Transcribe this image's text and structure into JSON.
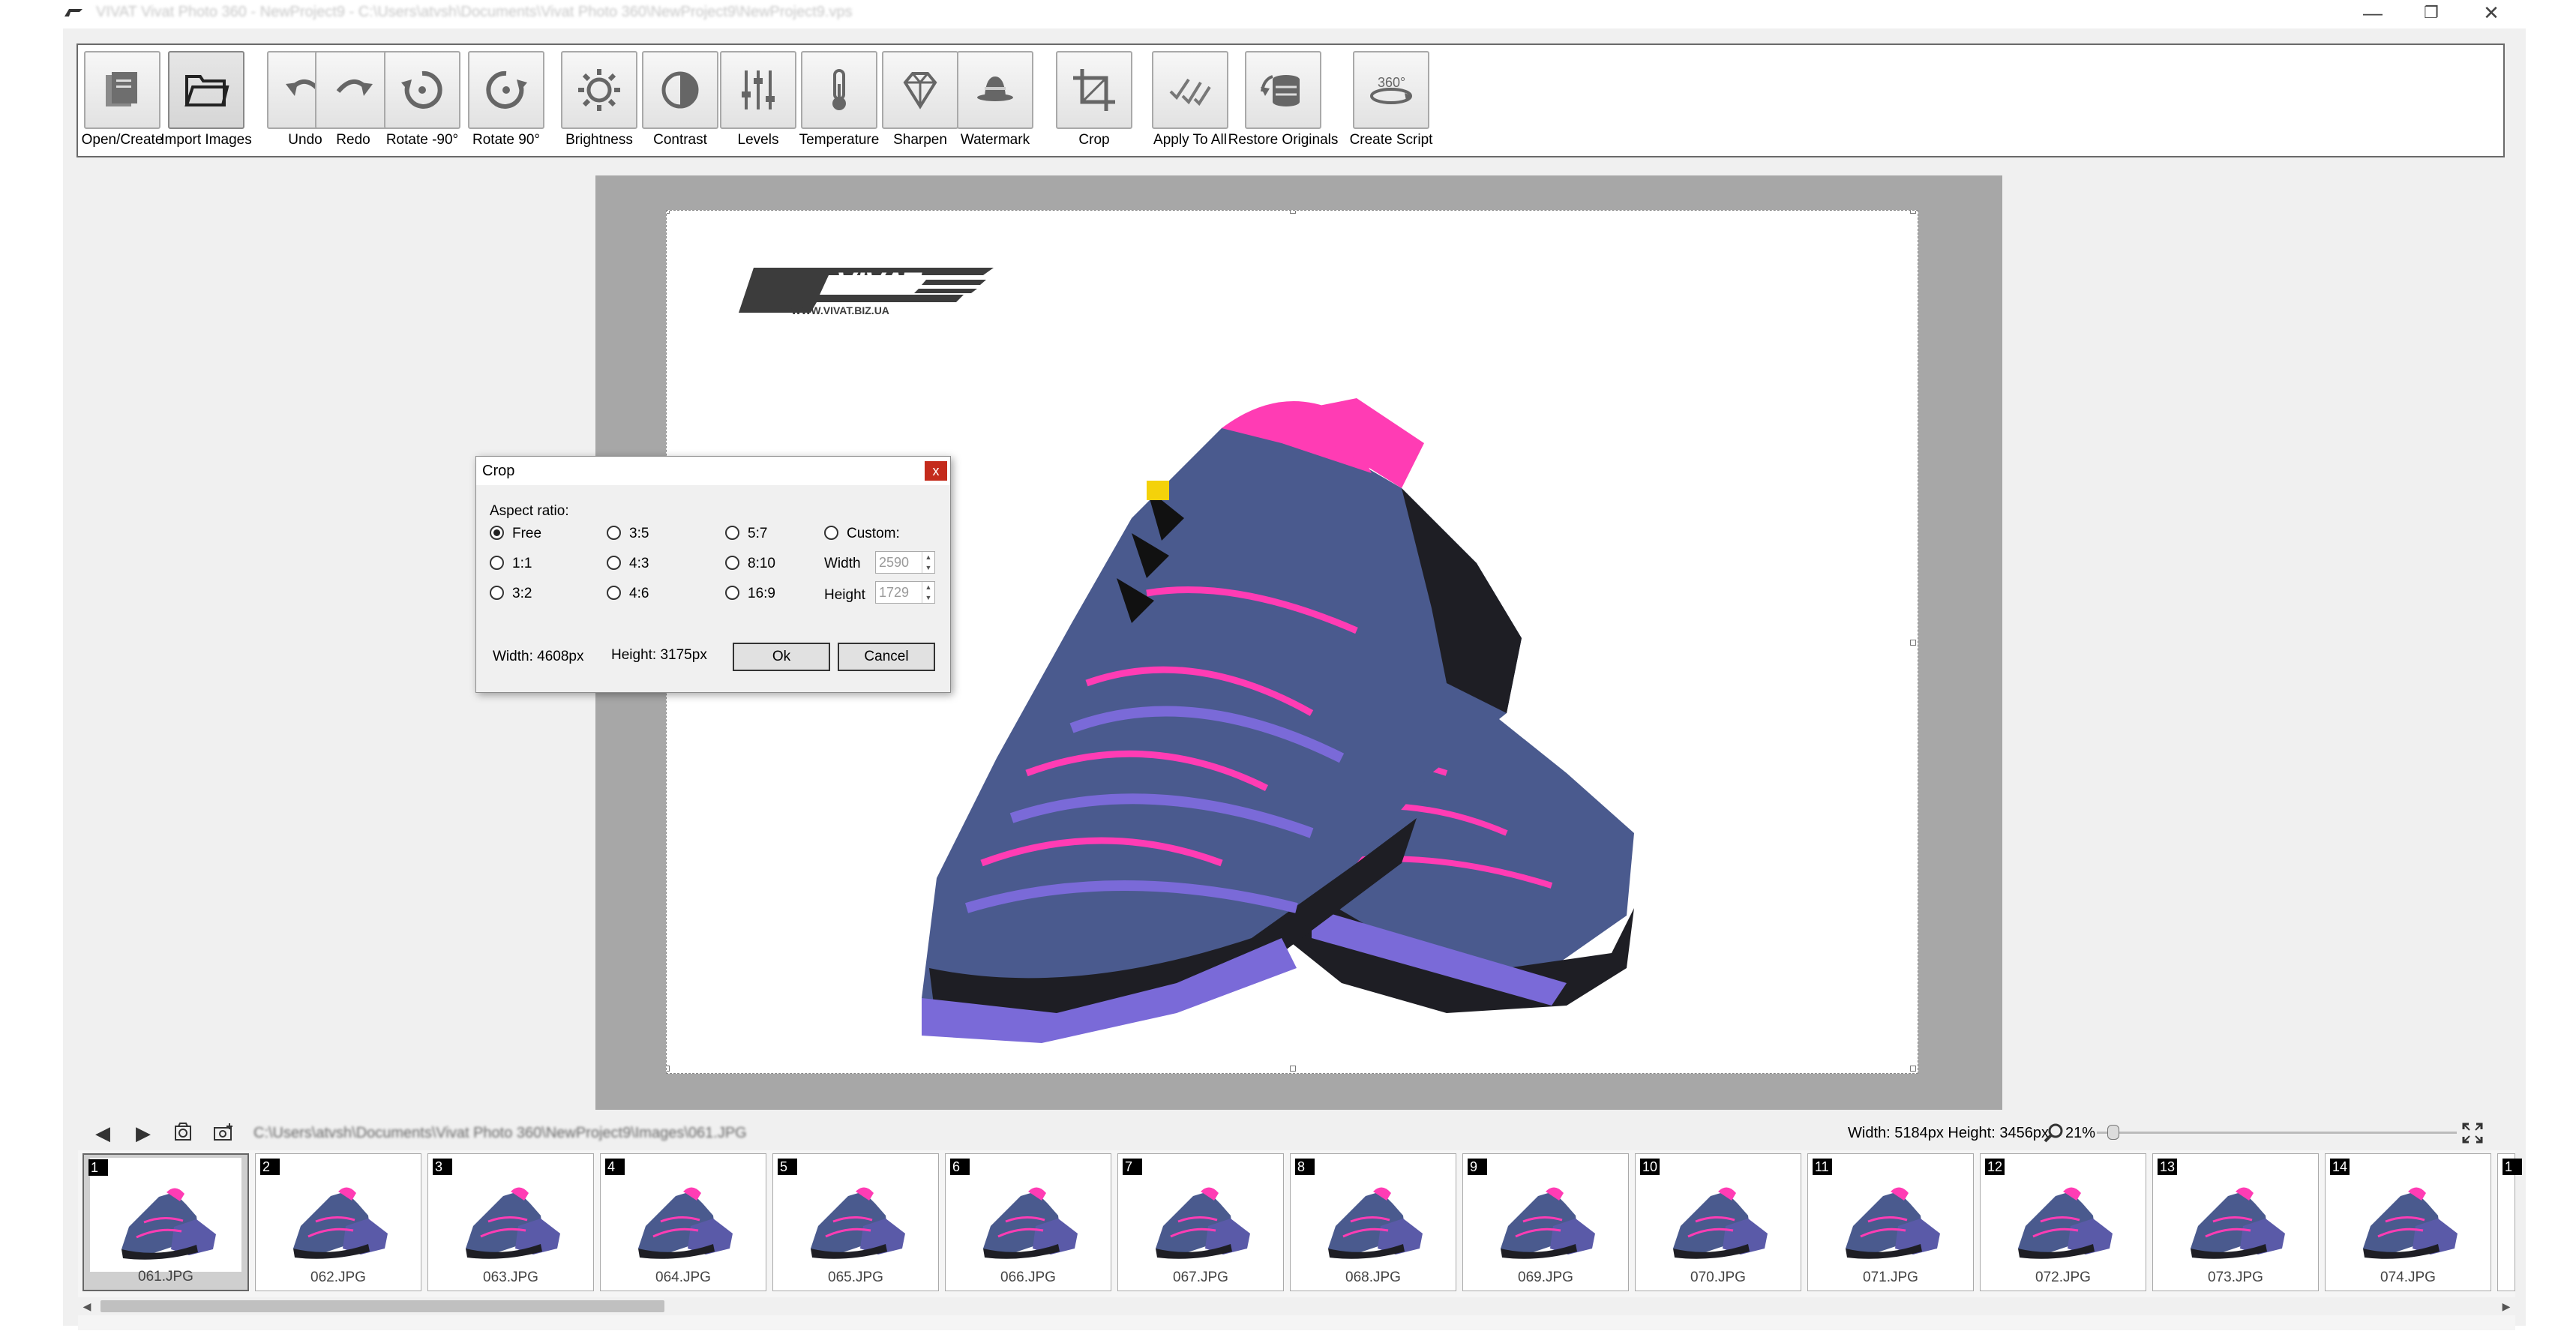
{
  "window": {
    "title": "VIVAT Vivat Photo 360 - NewProject9 - C:\\Users\\atvsh\\Documents\\Vivat Photo 360\\NewProject9\\NewProject9.vps",
    "minimize": "—",
    "maximize": "❐",
    "close": "✕"
  },
  "toolbar": [
    {
      "label": "Open/Create",
      "icon": "open-create-icon"
    },
    {
      "label": "Import Images",
      "icon": "folder-open-icon"
    },
    {
      "label": "Undo",
      "icon": "undo-icon"
    },
    {
      "label": "Redo",
      "icon": "redo-icon"
    },
    {
      "label": "Rotate -90°",
      "icon": "rotate-left-icon"
    },
    {
      "label": "Rotate 90°",
      "icon": "rotate-right-icon"
    },
    {
      "label": "Brightness",
      "icon": "sun-icon"
    },
    {
      "label": "Contrast",
      "icon": "contrast-icon"
    },
    {
      "label": "Levels",
      "icon": "sliders-icon"
    },
    {
      "label": "Temperature",
      "icon": "thermometer-icon"
    },
    {
      "label": "Sharpen",
      "icon": "diamond-icon"
    },
    {
      "label": "Watermark",
      "icon": "watermark-icon"
    },
    {
      "label": "Crop",
      "icon": "crop-icon"
    },
    {
      "label": "Apply To All",
      "icon": "checkmarks-icon"
    },
    {
      "label": "Restore Originals",
      "icon": "restore-icon"
    },
    {
      "label": "Create Script",
      "icon": "rotate-360-icon",
      "badge": "360°"
    }
  ],
  "image": {
    "logo_text": "VIVAT",
    "logo_url": "WWW.VIVAT.BIZ.UA"
  },
  "crop_dialog": {
    "title": "Crop",
    "close": "x",
    "aspect_ratio_label": "Aspect ratio:",
    "options": [
      "Free",
      "3:5",
      "5:7",
      "Custom:",
      "1:1",
      "4:3",
      "8:10",
      "3:2",
      "4:6",
      "16:9"
    ],
    "selected": "Free",
    "width_label": "Width",
    "height_label": "Height",
    "custom_width": "2590",
    "custom_height": "1729",
    "crop_width_text": "Width: 4608px",
    "crop_height_text": "Height: 3175px",
    "ok": "Ok",
    "cancel": "Cancel"
  },
  "nav": {
    "path": "C:\\Users\\atvsh\\Documents\\Vivat Photo 360\\NewProject9\\Images\\061.JPG",
    "info": "Width: 5184px Height: 3456px",
    "zoom": "21%",
    "zoom_fraction": 0.03
  },
  "filmstrip": {
    "items": [
      {
        "num": "1",
        "file": "061.JPG"
      },
      {
        "num": "2",
        "file": "062.JPG"
      },
      {
        "num": "3",
        "file": "063.JPG"
      },
      {
        "num": "4",
        "file": "064.JPG"
      },
      {
        "num": "5",
        "file": "065.JPG"
      },
      {
        "num": "6",
        "file": "066.JPG"
      },
      {
        "num": "7",
        "file": "067.JPG"
      },
      {
        "num": "8",
        "file": "068.JPG"
      },
      {
        "num": "9",
        "file": "069.JPG"
      },
      {
        "num": "10",
        "file": "070.JPG"
      },
      {
        "num": "11",
        "file": "071.JPG"
      },
      {
        "num": "12",
        "file": "072.JPG"
      },
      {
        "num": "13",
        "file": "073.JPG"
      },
      {
        "num": "14",
        "file": "074.JPG"
      },
      {
        "num": "1",
        "file": ""
      }
    ],
    "selected_index": 0
  },
  "colors": {
    "shoe_body": "#4a5a8e",
    "shoe_trim": "#7a6ad8",
    "shoe_accent": "#ff3cb4",
    "sole": "#1e1e24"
  }
}
